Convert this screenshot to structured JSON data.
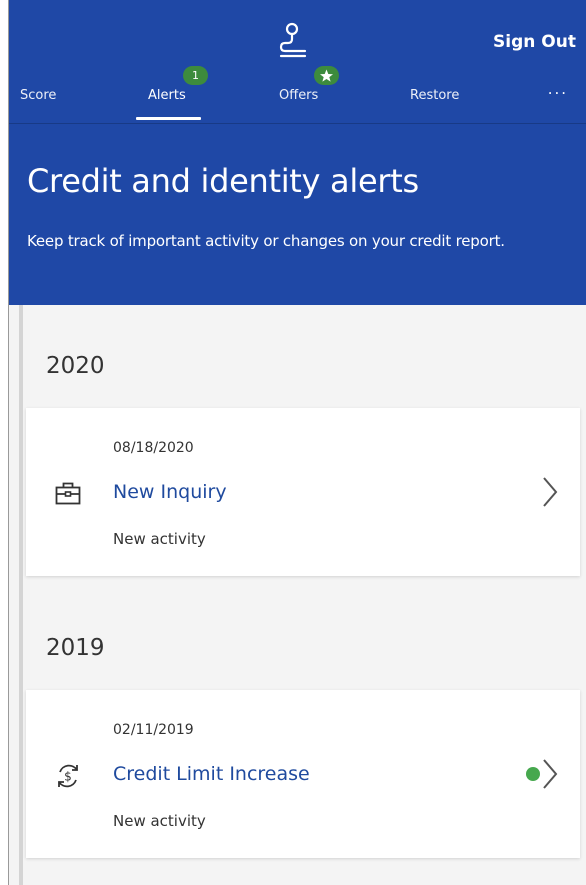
{
  "header": {
    "sign_out_label": "Sign Out",
    "tabs": [
      {
        "label": "Score"
      },
      {
        "label": "Alerts",
        "badge": "1"
      },
      {
        "label": "Offers",
        "badge_icon": "star-icon"
      },
      {
        "label": "Restore"
      }
    ],
    "more_label": "..."
  },
  "page": {
    "title": "Credit and identity alerts",
    "subtitle": "Keep track of important activity or changes on your credit report."
  },
  "groups": [
    {
      "year": "2020",
      "alerts": [
        {
          "date": "08/18/2020",
          "title": "New Inquiry",
          "status": "New activity",
          "icon": "briefcase-icon"
        }
      ]
    },
    {
      "year": "2019",
      "alerts": [
        {
          "date": "02/11/2019",
          "title": "Credit Limit Increase",
          "status": "New activity",
          "icon": "dollar-cycle-icon",
          "unread": true
        }
      ]
    }
  ],
  "colors": {
    "header_bg": "#1f48a6",
    "badge_green": "#3d8b3d",
    "link_blue": "#1f4a9e",
    "unread_dot": "#46a84e"
  }
}
